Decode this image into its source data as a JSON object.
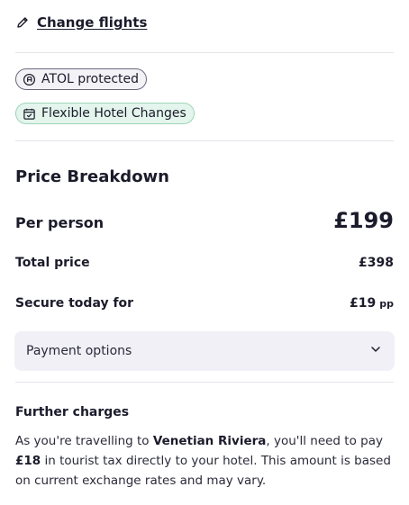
{
  "change_flights": {
    "label": "Change flights",
    "icon": "pencil-icon"
  },
  "badges": [
    {
      "label": "ATOL protected",
      "icon": "atol-icon"
    },
    {
      "label": "Flexible Hotel Changes",
      "icon": "calendar-check-icon"
    }
  ],
  "price_breakdown": {
    "title": "Price Breakdown",
    "per_person_label": "Per person",
    "per_person_value": "£199",
    "total_label": "Total price",
    "total_value": "£398",
    "secure_label": "Secure today for",
    "secure_value": "£19",
    "secure_suffix": "pp"
  },
  "payment_options": {
    "label": "Payment options",
    "icon": "chevron-down-icon"
  },
  "further_charges": {
    "title": "Further charges",
    "text_1": "As you're travelling to ",
    "destination": "Venetian Riviera",
    "text_2": ", you'll need to pay ",
    "amount": "£18",
    "text_3": " in tourist tax directly to your hotel. This amount is based on current exchange rates and may vary."
  },
  "colors": {
    "text": "#1b1b2b",
    "atol_badge_bg": "#f3f2f7",
    "hotel_badge_bg": "#e3f5ec",
    "hotel_badge_border": "#9fd4b9",
    "payment_bg": "#f1f0f6",
    "divider": "#e4e4ea"
  }
}
